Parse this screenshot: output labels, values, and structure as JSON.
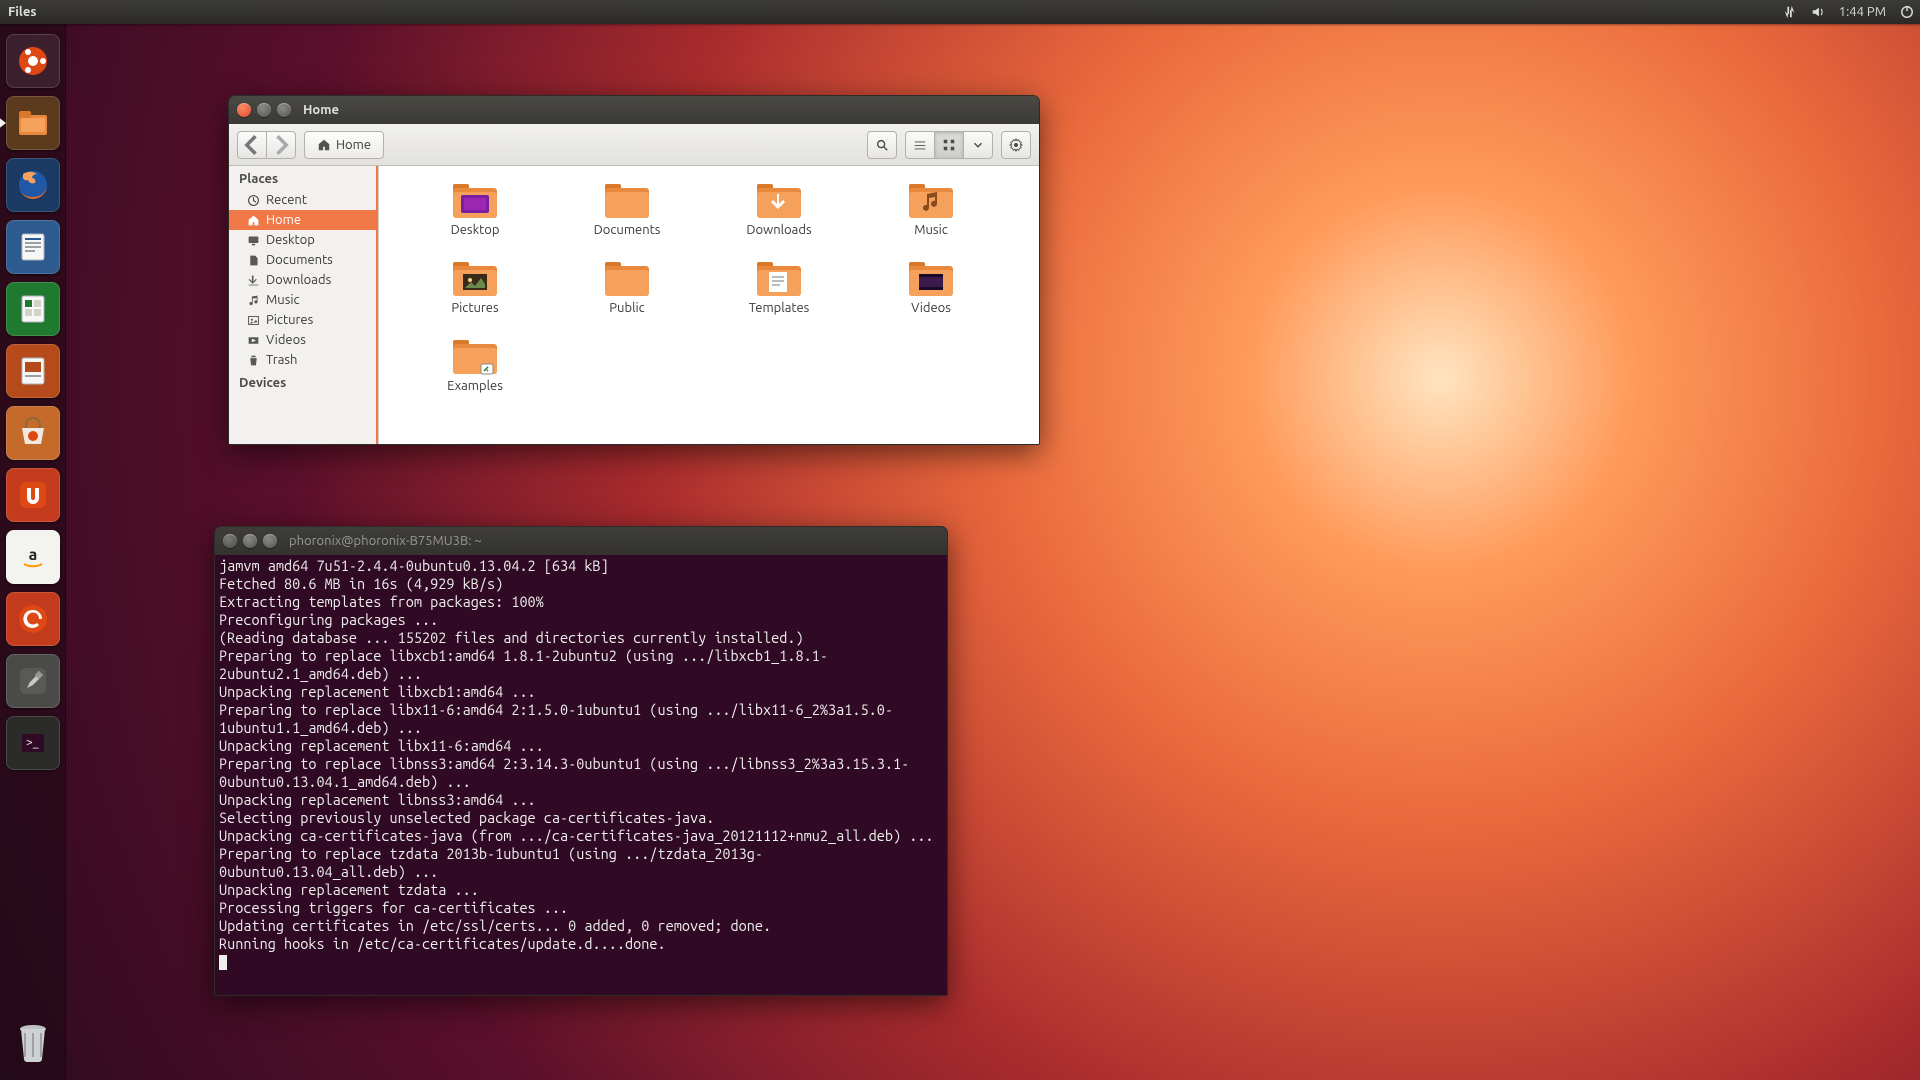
{
  "top_panel": {
    "app_menu": "Files",
    "time": "1:44 PM"
  },
  "launcher": {
    "items": [
      {
        "name": "dash-icon",
        "bg": "#3b1f2c"
      },
      {
        "name": "files-icon",
        "bg": "#5b3a1e",
        "active": true
      },
      {
        "name": "firefox-icon",
        "bg": "#1a3a63"
      },
      {
        "name": "writer-icon",
        "bg": "#2e5b8f"
      },
      {
        "name": "calc-icon",
        "bg": "#1f7a2f"
      },
      {
        "name": "impress-icon",
        "bg": "#b54b1a"
      },
      {
        "name": "software-center-icon",
        "bg": "#c46a2b"
      },
      {
        "name": "ubuntu-one-icon",
        "bg": "#c53b1d"
      },
      {
        "name": "amazon-icon",
        "bg": "#f3f3f0"
      },
      {
        "name": "update-manager-icon",
        "bg": "#c23b1c"
      },
      {
        "name": "settings-icon",
        "bg": "#4a4a48"
      },
      {
        "name": "terminal-icon",
        "bg": "#2b2b29"
      }
    ],
    "trash_name": "trash-icon"
  },
  "files_window": {
    "title": "Home",
    "path_segment": "Home",
    "places_heading": "Places",
    "devices_heading": "Devices",
    "places": [
      {
        "icon": "clock-icon",
        "label": "Recent"
      },
      {
        "icon": "home-icon",
        "label": "Home",
        "selected": true
      },
      {
        "icon": "desktop-icon",
        "label": "Desktop"
      },
      {
        "icon": "documents-icon",
        "label": "Documents"
      },
      {
        "icon": "downloads-icon",
        "label": "Downloads"
      },
      {
        "icon": "music-icon",
        "label": "Music"
      },
      {
        "icon": "pictures-icon",
        "label": "Pictures"
      },
      {
        "icon": "videos-icon",
        "label": "Videos"
      },
      {
        "icon": "trash-icon",
        "label": "Trash"
      }
    ],
    "folders": [
      {
        "label": "Desktop",
        "variant": "desktop"
      },
      {
        "label": "Documents",
        "variant": "plain"
      },
      {
        "label": "Downloads",
        "variant": "download"
      },
      {
        "label": "Music",
        "variant": "music"
      },
      {
        "label": "Pictures",
        "variant": "pictures"
      },
      {
        "label": "Public",
        "variant": "plain"
      },
      {
        "label": "Templates",
        "variant": "templates"
      },
      {
        "label": "Videos",
        "variant": "videos"
      },
      {
        "label": "Examples",
        "variant": "link"
      }
    ]
  },
  "terminal_window": {
    "title": "phoronix@phoronix-B75MU3B: ~",
    "lines": [
      "jamvm amd64 7u51-2.4.4-0ubuntu0.13.04.2 [634 kB]",
      "Fetched 80.6 MB in 16s (4,929 kB/s)",
      "Extracting templates from packages: 100%",
      "Preconfiguring packages ...",
      "(Reading database ... 155202 files and directories currently installed.)",
      "Preparing to replace libxcb1:amd64 1.8.1-2ubuntu2 (using .../libxcb1_1.8.1-2ubuntu2.1_amd64.deb) ...",
      "Unpacking replacement libxcb1:amd64 ...",
      "Preparing to replace libx11-6:amd64 2:1.5.0-1ubuntu1 (using .../libx11-6_2%3a1.5.0-1ubuntu1.1_amd64.deb) ...",
      "Unpacking replacement libx11-6:amd64 ...",
      "Preparing to replace libnss3:amd64 2:3.14.3-0ubuntu1 (using .../libnss3_2%3a3.15.3.1-0ubuntu0.13.04.1_amd64.deb) ...",
      "Unpacking replacement libnss3:amd64 ...",
      "Selecting previously unselected package ca-certificates-java.",
      "Unpacking ca-certificates-java (from .../ca-certificates-java_20121112+nmu2_all.deb) ...",
      "Preparing to replace tzdata 2013b-1ubuntu1 (using .../tzdata_2013g-0ubuntu0.13.04_all.deb) ...",
      "Unpacking replacement tzdata ...",
      "Processing triggers for ca-certificates ...",
      "Updating certificates in /etc/ssl/certs... 0 added, 0 removed; done.",
      "Running hooks in /etc/ca-certificates/update.d....done."
    ]
  }
}
